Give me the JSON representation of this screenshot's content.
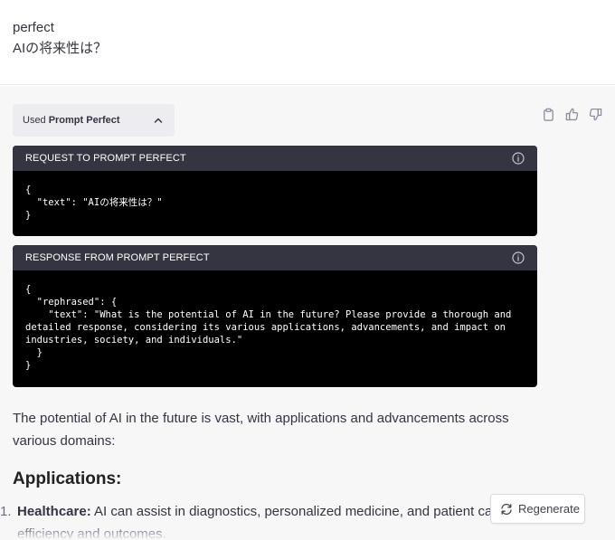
{
  "user_message": {
    "line1": "perfect",
    "line2": "AIの将来性は？"
  },
  "plugin": {
    "used_prefix": "Used",
    "name": "Prompt Perfect"
  },
  "request": {
    "header": "REQUEST TO PROMPT PERFECT",
    "code": "{\n  \"text\": \"AIの将来性は？\"\n}"
  },
  "response": {
    "header": "RESPONSE FROM PROMPT PERFECT",
    "code": "{\n  \"rephrased\": {\n    \"text\": \"What is the potential of AI in the future? Please provide a thorough and detailed response, considering its various applications, advancements, and impact on industries, society, and individuals.\"\n  }\n}"
  },
  "answer": {
    "paragraph": "The potential of AI in the future is vast, with applications and advancements across various domains:",
    "heading": "Applications:",
    "list": [
      {
        "number": "1.",
        "title": "Healthcare:",
        "text": " AI can assist in diagnostics, personalized medicine, and patient care, im",
        "continuation": "efficiency and outcomes."
      }
    ]
  },
  "actions": {
    "copy_icon": "clipboard-icon",
    "like_icon": "thumbs-up-icon",
    "dislike_icon": "thumbs-down-icon"
  },
  "regenerate": {
    "label": "Regenerate",
    "icon": "refresh-icon"
  },
  "colors": {
    "code_header_bg": "#343541",
    "code_bg": "#000000",
    "assistant_bg": "#f7f7f8",
    "plugin_pill_bg": "#ececf1"
  }
}
